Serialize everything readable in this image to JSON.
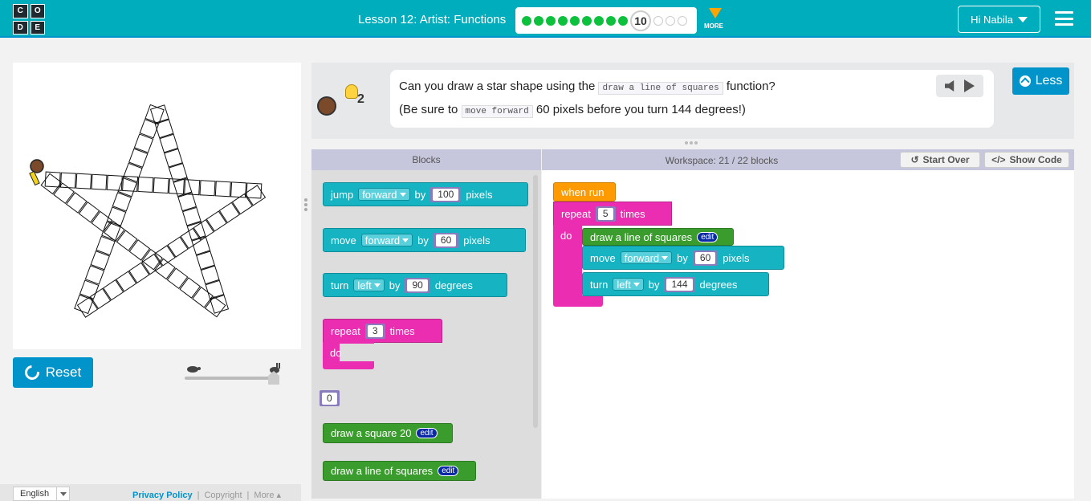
{
  "logo": {
    "letters": [
      "C",
      "O",
      "D",
      "E"
    ]
  },
  "header": {
    "lesson_title": "Lesson 12: Artist: Functions",
    "current_level": "10",
    "more_label": "MORE",
    "user_label": "Hi Nabila"
  },
  "instructions": {
    "hint_count": "2",
    "line1_before": "Can you draw a star shape using the ",
    "line1_code": "draw a line of squares",
    "line1_after": " function?",
    "line2_before": "(Be sure to ",
    "line2_code": "move forward",
    "line2_after": " 60 pixels before you turn 144 degrees!)",
    "less_label": "Less"
  },
  "controls": {
    "reset_label": "Reset"
  },
  "panels": {
    "blocks_header": "Blocks",
    "workspace_header": "Workspace: 21 / 22 blocks",
    "start_over_label": "Start Over",
    "show_code_label": "Show Code"
  },
  "toolbox": {
    "jump": {
      "verb": "jump",
      "dir": "forward",
      "by": "by",
      "value": "100",
      "unit": "pixels"
    },
    "move": {
      "verb": "move",
      "dir": "forward",
      "by": "by",
      "value": "60",
      "unit": "pixels"
    },
    "turn": {
      "verb": "turn",
      "dir": "left",
      "by": "by",
      "value": "90",
      "unit": "degrees"
    },
    "repeat": {
      "verb": "repeat",
      "value": "3",
      "unit": "times",
      "do": "do"
    },
    "number": "0",
    "draw_square": {
      "label": "draw a square 20",
      "edit": "edit"
    },
    "draw_line": {
      "label": "draw a line of squares",
      "edit": "edit"
    }
  },
  "workspace": {
    "when_run": "when run",
    "repeat": {
      "verb": "repeat",
      "value": "5",
      "unit": "times",
      "do": "do"
    },
    "draw_line": {
      "label": "draw a line of squares",
      "edit": "edit"
    },
    "move": {
      "verb": "move",
      "dir": "forward",
      "by": "by",
      "value": "60",
      "unit": "pixels"
    },
    "turn": {
      "verb": "turn",
      "dir": "left",
      "by": "by",
      "value": "144",
      "unit": "degrees"
    }
  },
  "footer": {
    "language": "English",
    "privacy": "Privacy Policy",
    "copyright": "Copyright",
    "more": "More ▴"
  },
  "icons": {
    "speed_slow": "turtle-icon",
    "speed_fast": "rabbit-icon",
    "reset": "reset-icon",
    "hint": "lightbulb-icon",
    "audio": "speaker-icon",
    "play": "play-icon"
  },
  "progress": {
    "completed": 9,
    "current": 10,
    "remaining": 3
  },
  "speed": {
    "value": 0.88
  },
  "colors": {
    "header_bg": "#00adbc",
    "accent_blue": "#0094ca",
    "progress_green": "#0ec13d",
    "block_teal": "#16b3c2",
    "block_pink": "#ea2db1",
    "block_green": "#3a9c2c",
    "block_orange": "#ff9b00"
  }
}
